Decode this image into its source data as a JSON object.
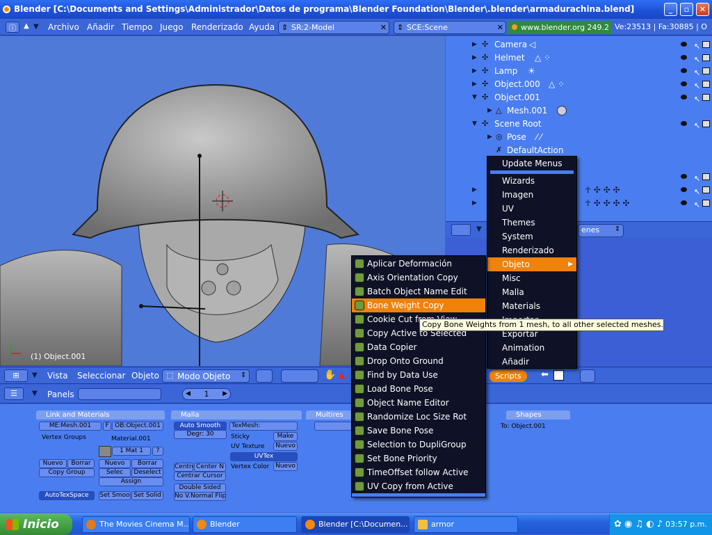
{
  "window": {
    "title": "Blender [C:\\Documents and Settings\\Administrador\\Datos de programa\\Blender Foundation\\Blender\\.blender\\armadurachina.blend]"
  },
  "menubar": {
    "items": [
      "Archivo",
      "Añadir",
      "Tiempo",
      "Juego",
      "Renderizado",
      "Ayuda"
    ],
    "screen_field": "SR:2-Model",
    "scene_field": "SCE:Scene",
    "url": "www.blender.org 249.2",
    "stats": "Ve:23513 | Fa:30885 | O"
  },
  "viewport": {
    "object_label": "(1) Object.001"
  },
  "outliner": {
    "rows": [
      {
        "label": "Camera",
        "extra": "◁"
      },
      {
        "label": "Helmet",
        "extra": "△ ⁘"
      },
      {
        "label": "Lamp",
        "extra": "☀"
      },
      {
        "label": "Object.000",
        "extra": "△ ⁘"
      },
      {
        "label": "Object.001",
        "extra": ""
      },
      {
        "label": "Mesh.001",
        "extra": ""
      },
      {
        "label": "Scene Root",
        "extra": ""
      },
      {
        "label": "Pose",
        "extra": ""
      },
      {
        "label": "DefaultAction",
        "extra": ""
      }
    ],
    "footer_text": "enes"
  },
  "view_header": {
    "menus": [
      "Vista",
      "Seleccionar",
      "Objeto"
    ],
    "mode": "Modo Objeto",
    "scripts": "Scripts"
  },
  "buttons_header": {
    "panels_label": "Panels",
    "frame": "1"
  },
  "panels": {
    "link_materials": {
      "title": "Link and Materials",
      "mesh": "ME:Mesh.001",
      "f": "F",
      "object": "OB:Object.001",
      "vertex_groups": "Vertex Groups",
      "material": "Material.001",
      "mat_nav": "1 Mat 1",
      "q": "?",
      "nuevo": "Nuevo",
      "borrar": "Borrar",
      "copy_group": "Copy Group",
      "selec": "Selec",
      "deselect": "Deselect",
      "assign": "Assign",
      "autotexspace": "AutoTexSpace",
      "set_smooth": "Set Smoo",
      "set_solid": "Set Solid"
    },
    "malla": {
      "title": "Malla",
      "auto_smooth": "Auto Smooth",
      "degr": "Degr: 30",
      "texmesh": "TexMesh:",
      "sticky": "Sticky",
      "make": "Make",
      "uv_texture": "UV Texture",
      "nuevo": "Nuevo",
      "uvtex": "UVTex",
      "vertex_color": "Vertex Color",
      "centre": "Centre",
      "center_n": "Center N",
      "centrar_cursor": "Centrar Cursor",
      "double_sided": "Double Sided",
      "no_vnormal": "No V.Normal Flip"
    },
    "multires": {
      "title": "Multires"
    },
    "shapes": {
      "title": "Shapes",
      "to": "To: Object.001"
    }
  },
  "scripts_menu": {
    "items": [
      "Aplicar Deformación",
      "Axis Orientation Copy",
      "Batch Object Name Edit",
      "Bone Weight Copy",
      "Cookie Cut from View",
      "Copy Active to Selected",
      "Data Copier",
      "Drop Onto Ground",
      "Find by Data Use",
      "Load Bone Pose",
      "Object Name Editor",
      "Randomize Loc Size Rot",
      "Save Bone Pose",
      "Selection to DupliGroup",
      "Set Bone Priority",
      "TimeOffset follow Active",
      "UV Copy from Active"
    ],
    "highlighted": 3
  },
  "categories_menu": {
    "items": [
      "Update Menus",
      "Wizards",
      "Imagen",
      "UV",
      "Themes",
      "System",
      "Renderizado",
      "Objeto",
      "Misc",
      "Malla",
      "Materials",
      "Importar",
      "Exportar",
      "Animation",
      "Añadir"
    ],
    "highlighted": 7
  },
  "tooltip": "Copy Bone Weights from 1 mesh, to all other selected meshes.",
  "taskbar": {
    "start": "Inicio",
    "tasks": [
      "The Movies Cinema M...",
      "Blender",
      "Blender [C:\\Documen...",
      "armor"
    ],
    "clock": "03:57 p.m."
  },
  "colors": {
    "highlight": "#f0820a",
    "menu_bg": "#0f1227",
    "panel_bg": "#4a7ef0"
  }
}
